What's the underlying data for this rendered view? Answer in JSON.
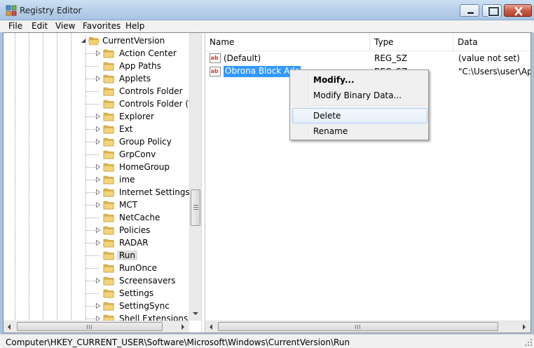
{
  "window": {
    "title": "Registry Editor"
  },
  "menu": {
    "items": [
      "File",
      "Edit",
      "View",
      "Favorites",
      "Help"
    ]
  },
  "tree": {
    "parent": "CurrentVersion",
    "items": [
      {
        "label": "Action Center",
        "expandable": true
      },
      {
        "label": "App Paths",
        "expandable": false
      },
      {
        "label": "Applets",
        "expandable": true
      },
      {
        "label": "Controls Folder",
        "expandable": false
      },
      {
        "label": "Controls Folder (Wo",
        "expandable": false
      },
      {
        "label": "Explorer",
        "expandable": true
      },
      {
        "label": "Ext",
        "expandable": true
      },
      {
        "label": "Group Policy",
        "expandable": true
      },
      {
        "label": "GrpConv",
        "expandable": false
      },
      {
        "label": "HomeGroup",
        "expandable": true
      },
      {
        "label": "ime",
        "expandable": true
      },
      {
        "label": "Internet Settings",
        "expandable": true
      },
      {
        "label": "MCT",
        "expandable": true
      },
      {
        "label": "NetCache",
        "expandable": false
      },
      {
        "label": "Policies",
        "expandable": true
      },
      {
        "label": "RADAR",
        "expandable": true
      },
      {
        "label": "Run",
        "expandable": false,
        "selected": true
      },
      {
        "label": "RunOnce",
        "expandable": false
      },
      {
        "label": "Screensavers",
        "expandable": true
      },
      {
        "label": "Settings",
        "expandable": false
      },
      {
        "label": "SettingSync",
        "expandable": true
      },
      {
        "label": "Shell Extensions",
        "expandable": true
      }
    ]
  },
  "list": {
    "columns": [
      "Name",
      "Type",
      "Data"
    ],
    "rows": [
      {
        "name": "(Default)",
        "type": "REG_SZ",
        "data": "(value not set)",
        "selected": false
      },
      {
        "name": "Obrona Block Ads",
        "type": "REG_SZ",
        "data": "\"C:\\Users\\user\\App",
        "selected": true
      }
    ]
  },
  "context_menu": {
    "items": [
      {
        "label": "Modify...",
        "bold": true
      },
      {
        "label": "Modify Binary Data..."
      },
      {
        "label": "Delete",
        "highlighted": true
      },
      {
        "label": "Rename"
      }
    ]
  },
  "status": {
    "path": "Computer\\HKEY_CURRENT_USER\\Software\\Microsoft\\Windows\\CurrentVersion\\Run"
  },
  "colors": {
    "selection": "#3399ff",
    "folder": "#e8b84a"
  }
}
